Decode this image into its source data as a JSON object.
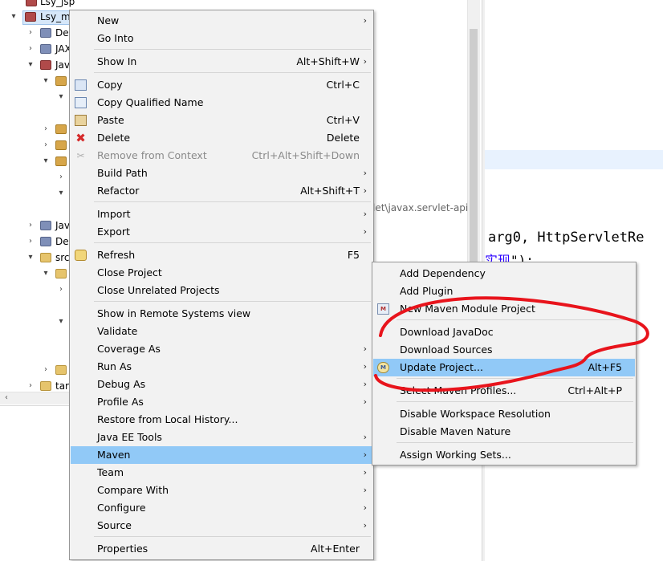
{
  "tree": {
    "rows": [
      {
        "label": "Lsy_jsp",
        "icon": "project-icon",
        "twisty": ""
      },
      {
        "label": "Lsy_m",
        "icon": "maven-project-icon",
        "twisty": "▾"
      },
      {
        "label": "De",
        "icon": "descriptor-icon",
        "twisty": "›"
      },
      {
        "label": "JAX",
        "icon": "jaxws-icon",
        "twisty": "›"
      },
      {
        "label": "Jav",
        "icon": "java-resources-icon",
        "twisty": "▾"
      },
      {
        "label": "",
        "icon": "source-folder-icon",
        "twisty": "▾"
      },
      {
        "label": "",
        "icon": "",
        "twisty": "▾"
      },
      {
        "label": "",
        "icon": "package-icon",
        "twisty": "›"
      },
      {
        "label": "",
        "icon": "package-icon",
        "twisty": "›"
      },
      {
        "label": "",
        "icon": "package-icon",
        "twisty": "▾"
      },
      {
        "label": "",
        "icon": "",
        "twisty": "›"
      },
      {
        "label": "",
        "icon": "",
        "twisty": "▾"
      },
      {
        "label": "Jav",
        "icon": "library-icon",
        "twisty": "›"
      },
      {
        "label": "De",
        "icon": "deployed-resources-icon",
        "twisty": "›"
      },
      {
        "label": "src",
        "icon": "folder-icon",
        "twisty": "▾"
      },
      {
        "label": "",
        "icon": "folder-icon",
        "twisty": "▾"
      },
      {
        "label": "",
        "icon": "",
        "twisty": "›"
      },
      {
        "label": "",
        "icon": "",
        "twisty": "▾"
      },
      {
        "label": "",
        "icon": "folder-icon",
        "twisty": "›"
      },
      {
        "label": "tar",
        "icon": "folder-icon",
        "twisty": "›"
      }
    ],
    "scroll_left_arrow": "‹"
  },
  "editor": {
    "path_text": "let\\javax.servlet-api",
    "code_line_1": "arg0, HttpServletRe",
    "code_line_2_string": "实现",
    "code_line_2_suffix": "\");"
  },
  "menu": {
    "items": [
      {
        "label": "New",
        "accel": "",
        "submenu": true
      },
      {
        "label": "Go Into",
        "accel": "",
        "submenu": false
      },
      {
        "label": "Show In",
        "accel": "Alt+Shift+W",
        "submenu": true
      },
      {
        "label": "Copy",
        "accel": "Ctrl+C",
        "submenu": false
      },
      {
        "label": "Copy Qualified Name",
        "accel": "",
        "submenu": false
      },
      {
        "label": "Paste",
        "accel": "Ctrl+V",
        "submenu": false
      },
      {
        "label": "Delete",
        "accel": "Delete",
        "submenu": false
      },
      {
        "label": "Remove from Context",
        "accel": "Ctrl+Alt+Shift+Down",
        "submenu": false
      },
      {
        "label": "Build Path",
        "accel": "",
        "submenu": true
      },
      {
        "label": "Refactor",
        "accel": "Alt+Shift+T",
        "submenu": true
      },
      {
        "label": "Import",
        "accel": "",
        "submenu": true
      },
      {
        "label": "Export",
        "accel": "",
        "submenu": true
      },
      {
        "label": "Refresh",
        "accel": "F5",
        "submenu": false
      },
      {
        "label": "Close Project",
        "accel": "",
        "submenu": false
      },
      {
        "label": "Close Unrelated Projects",
        "accel": "",
        "submenu": false
      },
      {
        "label": "Show in Remote Systems view",
        "accel": "",
        "submenu": false
      },
      {
        "label": "Validate",
        "accel": "",
        "submenu": false
      },
      {
        "label": "Coverage As",
        "accel": "",
        "submenu": true
      },
      {
        "label": "Run As",
        "accel": "",
        "submenu": true
      },
      {
        "label": "Debug As",
        "accel": "",
        "submenu": true
      },
      {
        "label": "Profile As",
        "accel": "",
        "submenu": true
      },
      {
        "label": "Restore from Local History...",
        "accel": "",
        "submenu": false
      },
      {
        "label": "Java EE Tools",
        "accel": "",
        "submenu": true
      },
      {
        "label": "Maven",
        "accel": "",
        "submenu": true
      },
      {
        "label": "Team",
        "accel": "",
        "submenu": true
      },
      {
        "label": "Compare With",
        "accel": "",
        "submenu": true
      },
      {
        "label": "Configure",
        "accel": "",
        "submenu": true
      },
      {
        "label": "Source",
        "accel": "",
        "submenu": true
      },
      {
        "label": "Properties",
        "accel": "Alt+Enter",
        "submenu": false
      }
    ],
    "submenu_arrow": "›"
  },
  "maven_menu": {
    "items": [
      {
        "label": "Add Dependency",
        "accel": ""
      },
      {
        "label": "Add Plugin",
        "accel": ""
      },
      {
        "label": "New Maven Module Project",
        "accel": ""
      },
      {
        "label": "Download JavaDoc",
        "accel": ""
      },
      {
        "label": "Download Sources",
        "accel": ""
      },
      {
        "label": "Update Project...",
        "accel": "Alt+F5"
      },
      {
        "label": "Select Maven Profiles...",
        "accel": "Ctrl+Alt+P"
      },
      {
        "label": "Disable Workspace Resolution",
        "accel": ""
      },
      {
        "label": "Disable Maven Nature",
        "accel": ""
      },
      {
        "label": "Assign Working Sets...",
        "accel": ""
      }
    ],
    "maven_icon_text": "M",
    "update_icon_text": "M"
  },
  "colors": {
    "highlight": "#91c9f7",
    "annotation": "#e8141c",
    "menu_bg": "#f2f2f2"
  }
}
